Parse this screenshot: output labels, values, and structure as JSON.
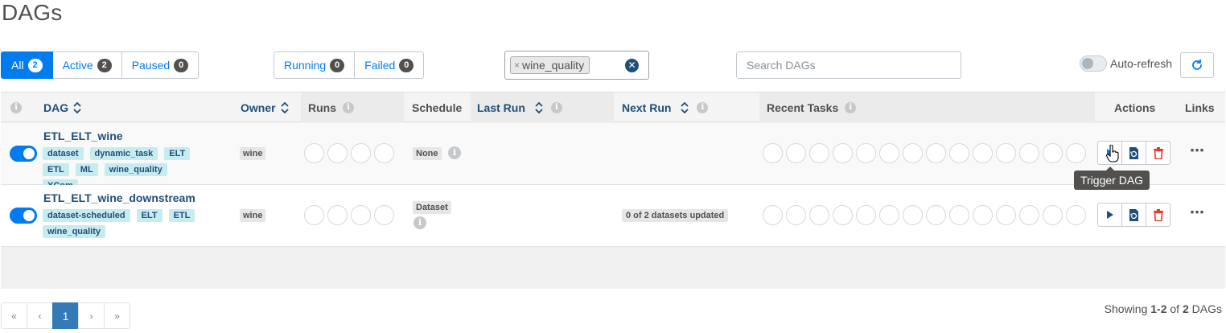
{
  "page": {
    "title": "DAGs"
  },
  "status_filter": [
    {
      "label": "All",
      "count": "2",
      "active": true
    },
    {
      "label": "Active",
      "count": "2",
      "active": false
    },
    {
      "label": "Paused",
      "count": "0",
      "active": false
    }
  ],
  "run_filter": [
    {
      "label": "Running",
      "count": "0"
    },
    {
      "label": "Failed",
      "count": "0"
    }
  ],
  "tag_filter": {
    "chip_remove": "×",
    "chip_label": "wine_quality"
  },
  "search": {
    "placeholder": "Search DAGs",
    "value": ""
  },
  "auto_refresh": {
    "label": "Auto-refresh",
    "enabled": false
  },
  "columns": {
    "dag": "DAG",
    "owner": "Owner",
    "runs": "Runs",
    "schedule": "Schedule",
    "last_run": "Last Run",
    "next_run": "Next Run",
    "recent_tasks": "Recent Tasks",
    "actions": "Actions",
    "links": "Links"
  },
  "rows": [
    {
      "dag_id": "ETL_ELT_wine",
      "paused": false,
      "tags": [
        "dataset",
        "dynamic_task",
        "ELT",
        "ETL",
        "ML",
        "wine_quality",
        "XCom"
      ],
      "owner": "wine",
      "schedule": "None",
      "next_run": ""
    },
    {
      "dag_id": "ETL_ELT_wine_downstream",
      "paused": false,
      "tags": [
        "dataset-scheduled",
        "ELT",
        "ETL",
        "wine_quality"
      ],
      "owner": "wine",
      "schedule": "Dataset",
      "next_run": "0 of 2 datasets updated"
    }
  ],
  "tooltip": {
    "text": "Trigger DAG"
  },
  "pagination": {
    "first": "«",
    "prev": "‹",
    "current": "1",
    "next": "›",
    "last": "»"
  },
  "footer": {
    "prefix": "Showing ",
    "range": "1-2",
    "middle": " of ",
    "total": "2",
    "suffix": " DAGs"
  },
  "colors": {
    "accent": "#017cee",
    "link": "#1f4e79",
    "tag_bg": "#c6ecf0",
    "delete": "#e43921"
  },
  "icons": {
    "info": "info-icon",
    "sort": "sort-icon",
    "refresh": "refresh-icon",
    "trigger": "play-icon",
    "clear": "clear-icon",
    "delete": "trash-icon",
    "more": "more-icon"
  }
}
